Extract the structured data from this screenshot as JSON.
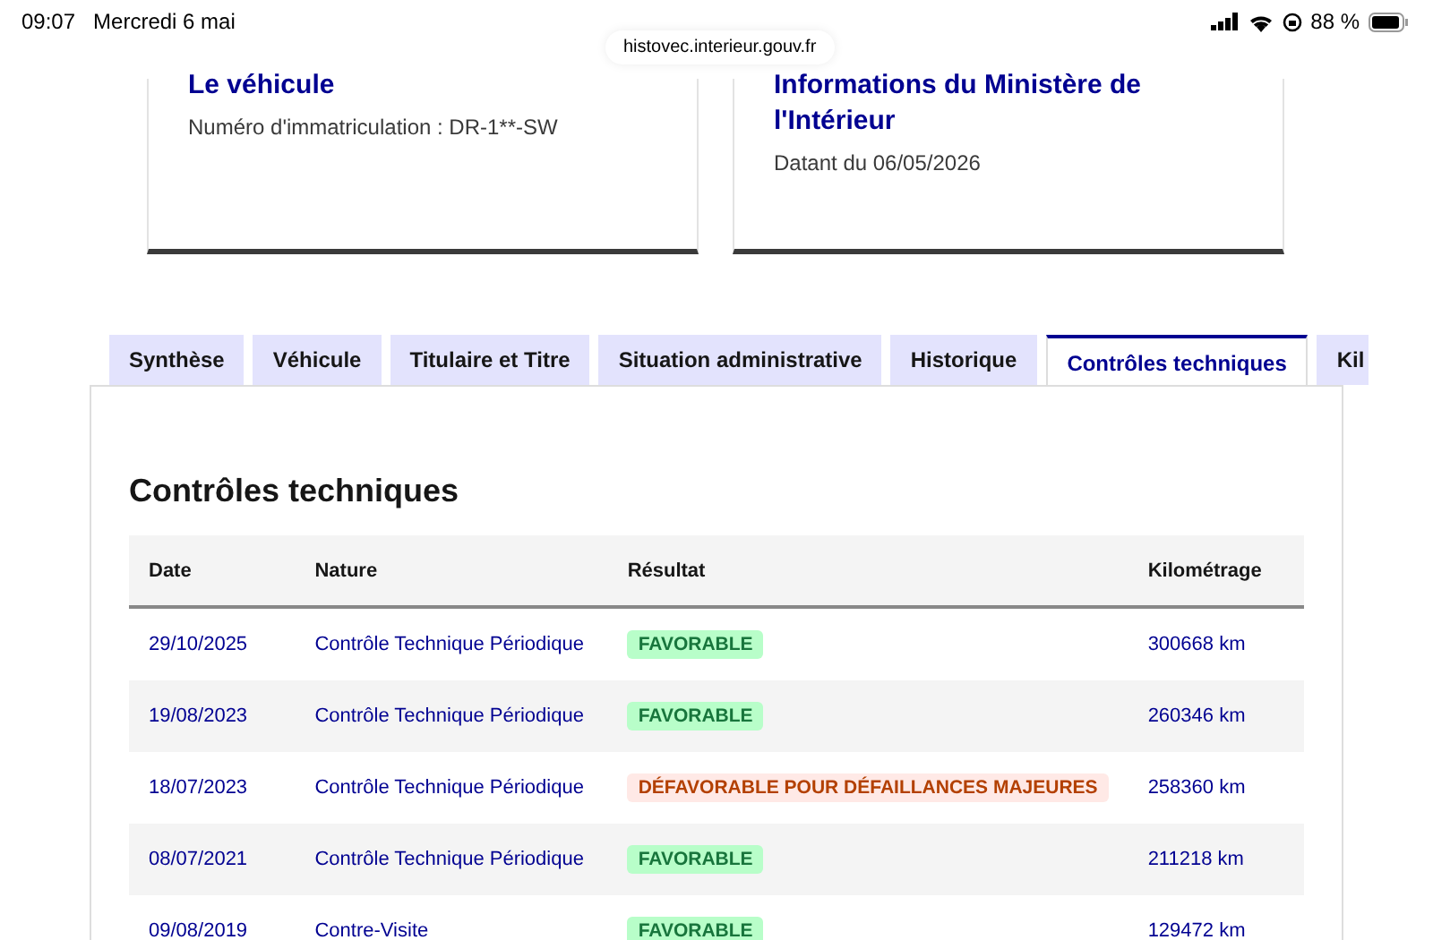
{
  "status_bar": {
    "time": "09:07",
    "date": "Mercredi 6 mai",
    "battery": "88 %",
    "url": "histovec.interieur.gouv.fr"
  },
  "cards": [
    {
      "title": "Le véhicule",
      "text": "Numéro d'immatriculation : DR-1**-SW"
    },
    {
      "title": "Informations du Ministère de l'Intérieur",
      "text": "Datant du 06/05/2026"
    }
  ],
  "tabs": [
    {
      "label": "Synthèse",
      "selected": false
    },
    {
      "label": "Véhicule",
      "selected": false
    },
    {
      "label": "Titulaire et Titre",
      "selected": false
    },
    {
      "label": "Situation administrative",
      "selected": false
    },
    {
      "label": "Historique",
      "selected": false
    },
    {
      "label": "Contrôles techniques",
      "selected": true
    },
    {
      "label": "Kil",
      "selected": false
    }
  ],
  "section_title": "Contrôles techniques",
  "table": {
    "columns": [
      "Date",
      "Nature",
      "Résultat",
      "Kilométrage"
    ],
    "rows": [
      {
        "date": "29/10/2025",
        "nature": "Contrôle Technique Périodique",
        "result": {
          "label": "FAVORABLE",
          "kind": "favorable"
        },
        "km": "300668 km"
      },
      {
        "date": "19/08/2023",
        "nature": "Contrôle Technique Périodique",
        "result": {
          "label": "FAVORABLE",
          "kind": "favorable"
        },
        "km": "260346 km"
      },
      {
        "date": "18/07/2023",
        "nature": "Contrôle Technique Périodique",
        "result": {
          "label": "DÉFAVORABLE POUR DÉFAILLANCES MAJEURES",
          "kind": "defavorable"
        },
        "km": "258360 km"
      },
      {
        "date": "08/07/2021",
        "nature": "Contrôle Technique Périodique",
        "result": {
          "label": "FAVORABLE",
          "kind": "favorable"
        },
        "km": "211218 km"
      },
      {
        "date": "09/08/2019",
        "nature": "Contre-Visite",
        "result": {
          "label": "FAVORABLE",
          "kind": "favorable"
        },
        "km": "129472 km"
      }
    ]
  }
}
